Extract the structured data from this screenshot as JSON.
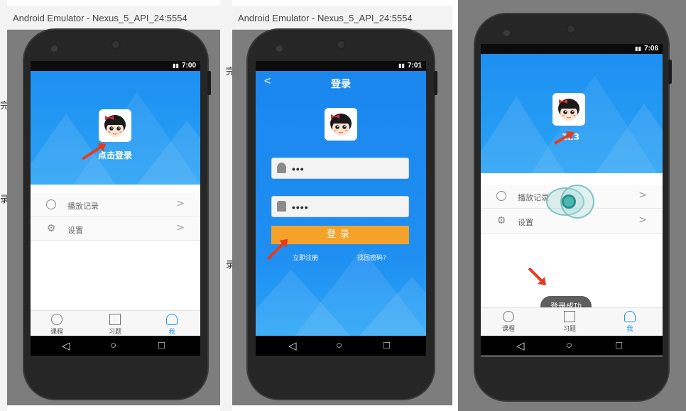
{
  "windows": [
    {
      "title": "Android Emulator - Nexus_5_API_24:5554"
    },
    {
      "title": "Android Emulator - Nexus_5_API_24:5554"
    }
  ],
  "background_fragments": [
    "完",
    "录",
    "完",
    "录"
  ],
  "screen1": {
    "status_time": "7:00",
    "hero_text": "点击登录",
    "menu": [
      {
        "label": "播放记录",
        "icon": "clock-icon"
      },
      {
        "label": "设置",
        "icon": "gear-icon"
      }
    ],
    "tabs": [
      {
        "label": "课程",
        "icon": "play-circle-icon",
        "active": false
      },
      {
        "label": "习题",
        "icon": "list-icon",
        "active": false
      },
      {
        "label": "我",
        "icon": "person-icon",
        "active": true
      }
    ]
  },
  "screen2": {
    "status_time": "7:01",
    "title": "登录",
    "back_glyph": "<",
    "username_value": "•••",
    "password_value": "••••",
    "login_button": "登录",
    "register_link": "立即注册",
    "forgot_link": "找回密码?"
  },
  "screen3": {
    "status_time": "7:06",
    "hero_text": "123",
    "menu": [
      {
        "label": "播放记录",
        "icon": "clock-icon"
      },
      {
        "label": "设置",
        "icon": "gear-icon"
      }
    ],
    "toast": "登录成功",
    "tabs": [
      {
        "label": "课程",
        "icon": "play-circle-icon",
        "active": false
      },
      {
        "label": "习题",
        "icon": "list-icon",
        "active": false
      },
      {
        "label": "我",
        "icon": "person-icon",
        "active": true
      }
    ]
  },
  "nav_glyphs": {
    "back": "◁",
    "home": "○",
    "recent": "□"
  },
  "colors": {
    "hero_blue": "#1d8ff1",
    "login_orange": "#f5a22a",
    "active_tab": "#1e8ff0",
    "annotation_red": "#e53b1e"
  }
}
